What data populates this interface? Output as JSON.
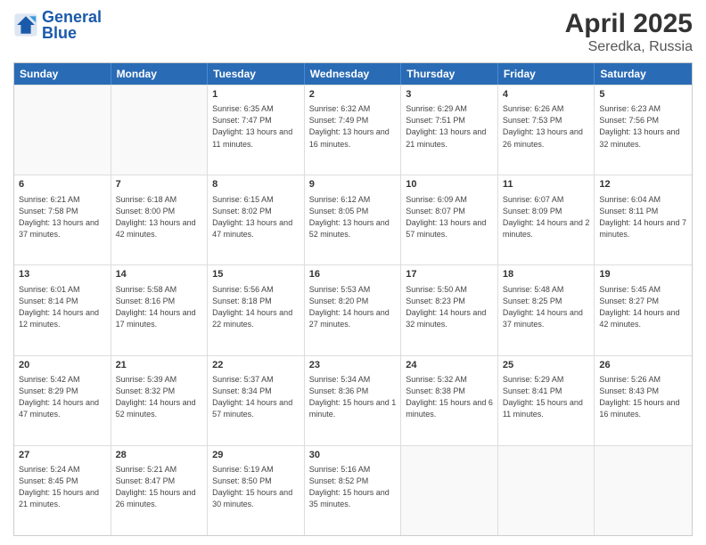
{
  "header": {
    "logo_general": "General",
    "logo_blue": "Blue",
    "month": "April 2025",
    "location": "Seredka, Russia"
  },
  "days_of_week": [
    "Sunday",
    "Monday",
    "Tuesday",
    "Wednesday",
    "Thursday",
    "Friday",
    "Saturday"
  ],
  "weeks": [
    [
      {
        "day": "",
        "sunrise": "",
        "sunset": "",
        "daylight": ""
      },
      {
        "day": "",
        "sunrise": "",
        "sunset": "",
        "daylight": ""
      },
      {
        "day": "1",
        "sunrise": "Sunrise: 6:35 AM",
        "sunset": "Sunset: 7:47 PM",
        "daylight": "Daylight: 13 hours and 11 minutes."
      },
      {
        "day": "2",
        "sunrise": "Sunrise: 6:32 AM",
        "sunset": "Sunset: 7:49 PM",
        "daylight": "Daylight: 13 hours and 16 minutes."
      },
      {
        "day": "3",
        "sunrise": "Sunrise: 6:29 AM",
        "sunset": "Sunset: 7:51 PM",
        "daylight": "Daylight: 13 hours and 21 minutes."
      },
      {
        "day": "4",
        "sunrise": "Sunrise: 6:26 AM",
        "sunset": "Sunset: 7:53 PM",
        "daylight": "Daylight: 13 hours and 26 minutes."
      },
      {
        "day": "5",
        "sunrise": "Sunrise: 6:23 AM",
        "sunset": "Sunset: 7:56 PM",
        "daylight": "Daylight: 13 hours and 32 minutes."
      }
    ],
    [
      {
        "day": "6",
        "sunrise": "Sunrise: 6:21 AM",
        "sunset": "Sunset: 7:58 PM",
        "daylight": "Daylight: 13 hours and 37 minutes."
      },
      {
        "day": "7",
        "sunrise": "Sunrise: 6:18 AM",
        "sunset": "Sunset: 8:00 PM",
        "daylight": "Daylight: 13 hours and 42 minutes."
      },
      {
        "day": "8",
        "sunrise": "Sunrise: 6:15 AM",
        "sunset": "Sunset: 8:02 PM",
        "daylight": "Daylight: 13 hours and 47 minutes."
      },
      {
        "day": "9",
        "sunrise": "Sunrise: 6:12 AM",
        "sunset": "Sunset: 8:05 PM",
        "daylight": "Daylight: 13 hours and 52 minutes."
      },
      {
        "day": "10",
        "sunrise": "Sunrise: 6:09 AM",
        "sunset": "Sunset: 8:07 PM",
        "daylight": "Daylight: 13 hours and 57 minutes."
      },
      {
        "day": "11",
        "sunrise": "Sunrise: 6:07 AM",
        "sunset": "Sunset: 8:09 PM",
        "daylight": "Daylight: 14 hours and 2 minutes."
      },
      {
        "day": "12",
        "sunrise": "Sunrise: 6:04 AM",
        "sunset": "Sunset: 8:11 PM",
        "daylight": "Daylight: 14 hours and 7 minutes."
      }
    ],
    [
      {
        "day": "13",
        "sunrise": "Sunrise: 6:01 AM",
        "sunset": "Sunset: 8:14 PM",
        "daylight": "Daylight: 14 hours and 12 minutes."
      },
      {
        "day": "14",
        "sunrise": "Sunrise: 5:58 AM",
        "sunset": "Sunset: 8:16 PM",
        "daylight": "Daylight: 14 hours and 17 minutes."
      },
      {
        "day": "15",
        "sunrise": "Sunrise: 5:56 AM",
        "sunset": "Sunset: 8:18 PM",
        "daylight": "Daylight: 14 hours and 22 minutes."
      },
      {
        "day": "16",
        "sunrise": "Sunrise: 5:53 AM",
        "sunset": "Sunset: 8:20 PM",
        "daylight": "Daylight: 14 hours and 27 minutes."
      },
      {
        "day": "17",
        "sunrise": "Sunrise: 5:50 AM",
        "sunset": "Sunset: 8:23 PM",
        "daylight": "Daylight: 14 hours and 32 minutes."
      },
      {
        "day": "18",
        "sunrise": "Sunrise: 5:48 AM",
        "sunset": "Sunset: 8:25 PM",
        "daylight": "Daylight: 14 hours and 37 minutes."
      },
      {
        "day": "19",
        "sunrise": "Sunrise: 5:45 AM",
        "sunset": "Sunset: 8:27 PM",
        "daylight": "Daylight: 14 hours and 42 minutes."
      }
    ],
    [
      {
        "day": "20",
        "sunrise": "Sunrise: 5:42 AM",
        "sunset": "Sunset: 8:29 PM",
        "daylight": "Daylight: 14 hours and 47 minutes."
      },
      {
        "day": "21",
        "sunrise": "Sunrise: 5:39 AM",
        "sunset": "Sunset: 8:32 PM",
        "daylight": "Daylight: 14 hours and 52 minutes."
      },
      {
        "day": "22",
        "sunrise": "Sunrise: 5:37 AM",
        "sunset": "Sunset: 8:34 PM",
        "daylight": "Daylight: 14 hours and 57 minutes."
      },
      {
        "day": "23",
        "sunrise": "Sunrise: 5:34 AM",
        "sunset": "Sunset: 8:36 PM",
        "daylight": "Daylight: 15 hours and 1 minute."
      },
      {
        "day": "24",
        "sunrise": "Sunrise: 5:32 AM",
        "sunset": "Sunset: 8:38 PM",
        "daylight": "Daylight: 15 hours and 6 minutes."
      },
      {
        "day": "25",
        "sunrise": "Sunrise: 5:29 AM",
        "sunset": "Sunset: 8:41 PM",
        "daylight": "Daylight: 15 hours and 11 minutes."
      },
      {
        "day": "26",
        "sunrise": "Sunrise: 5:26 AM",
        "sunset": "Sunset: 8:43 PM",
        "daylight": "Daylight: 15 hours and 16 minutes."
      }
    ],
    [
      {
        "day": "27",
        "sunrise": "Sunrise: 5:24 AM",
        "sunset": "Sunset: 8:45 PM",
        "daylight": "Daylight: 15 hours and 21 minutes."
      },
      {
        "day": "28",
        "sunrise": "Sunrise: 5:21 AM",
        "sunset": "Sunset: 8:47 PM",
        "daylight": "Daylight: 15 hours and 26 minutes."
      },
      {
        "day": "29",
        "sunrise": "Sunrise: 5:19 AM",
        "sunset": "Sunset: 8:50 PM",
        "daylight": "Daylight: 15 hours and 30 minutes."
      },
      {
        "day": "30",
        "sunrise": "Sunrise: 5:16 AM",
        "sunset": "Sunset: 8:52 PM",
        "daylight": "Daylight: 15 hours and 35 minutes."
      },
      {
        "day": "",
        "sunrise": "",
        "sunset": "",
        "daylight": ""
      },
      {
        "day": "",
        "sunrise": "",
        "sunset": "",
        "daylight": ""
      },
      {
        "day": "",
        "sunrise": "",
        "sunset": "",
        "daylight": ""
      }
    ]
  ]
}
